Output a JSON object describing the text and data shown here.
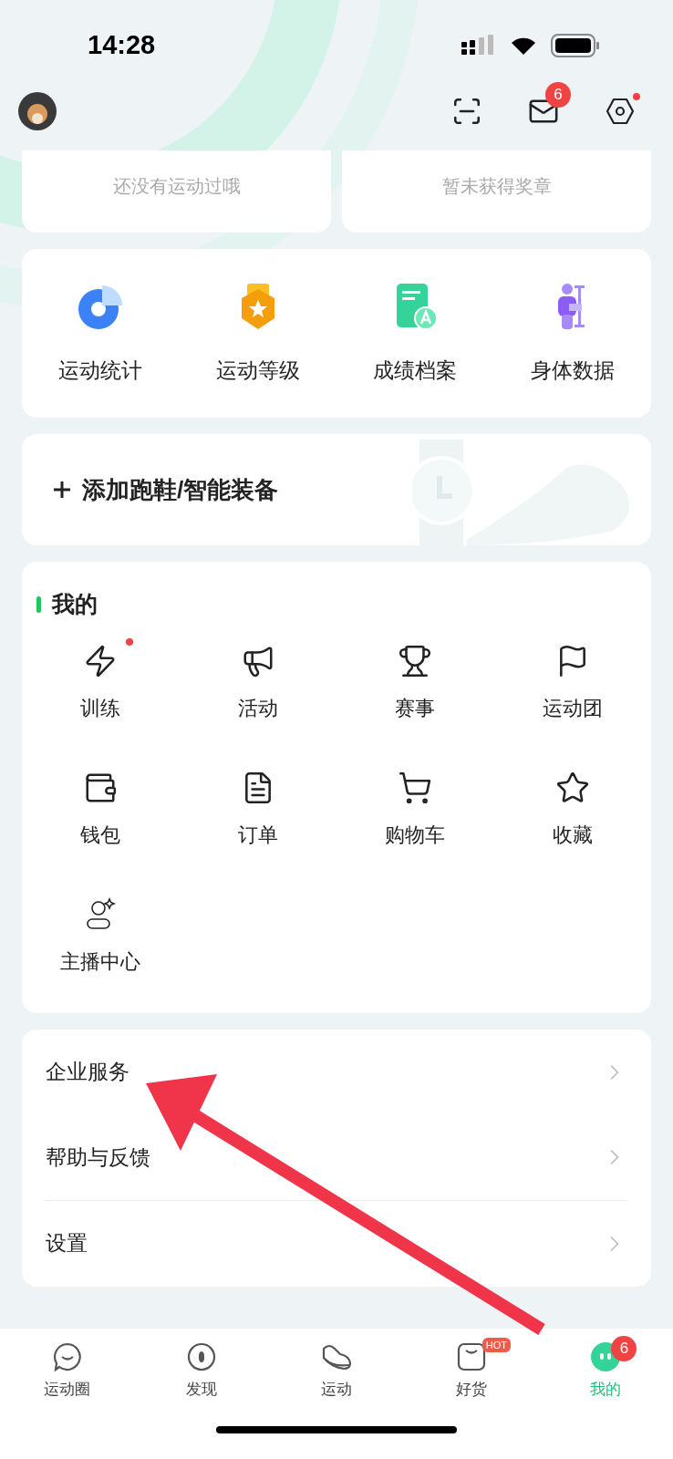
{
  "status_bar": {
    "time": "14:28"
  },
  "header": {
    "message_badge": "6",
    "settings_dot": true
  },
  "summary_cards": [
    {
      "text": "还没有运动过哦"
    },
    {
      "text": "暂未获得奖章"
    }
  ],
  "stats": [
    {
      "label": "运动统计",
      "kind": "chart"
    },
    {
      "label": "运动等级",
      "kind": "medal"
    },
    {
      "label": "成绩档案",
      "kind": "record"
    },
    {
      "label": "身体数据",
      "kind": "body"
    }
  ],
  "add_device": {
    "label": "添加跑鞋/智能装备"
  },
  "mine": {
    "title": "我的",
    "items": [
      {
        "label": "训练",
        "kind": "zap",
        "dot": true
      },
      {
        "label": "活动",
        "kind": "megaphone",
        "dot": false
      },
      {
        "label": "赛事",
        "kind": "trophy",
        "dot": false
      },
      {
        "label": "运动团",
        "kind": "flag",
        "dot": false
      },
      {
        "label": "钱包",
        "kind": "wallet",
        "dot": false
      },
      {
        "label": "订单",
        "kind": "order",
        "dot": false
      },
      {
        "label": "购物车",
        "kind": "cart",
        "dot": false
      },
      {
        "label": "收藏",
        "kind": "star",
        "dot": false
      },
      {
        "label": "主播中心",
        "kind": "anchor",
        "dot": false
      }
    ]
  },
  "menu": [
    {
      "label": "企业服务"
    },
    {
      "label": "帮助与反馈"
    },
    {
      "label": "设置"
    }
  ],
  "tab_bar": [
    {
      "label": "运动圈",
      "kind": "chat",
      "selected": false
    },
    {
      "label": "发现",
      "kind": "discover",
      "selected": false
    },
    {
      "label": "运动",
      "kind": "shoe",
      "selected": false
    },
    {
      "label": "好货",
      "kind": "bag",
      "selected": false,
      "tag": "HOT"
    },
    {
      "label": "我的",
      "kind": "me",
      "selected": true,
      "badge": "6"
    }
  ]
}
